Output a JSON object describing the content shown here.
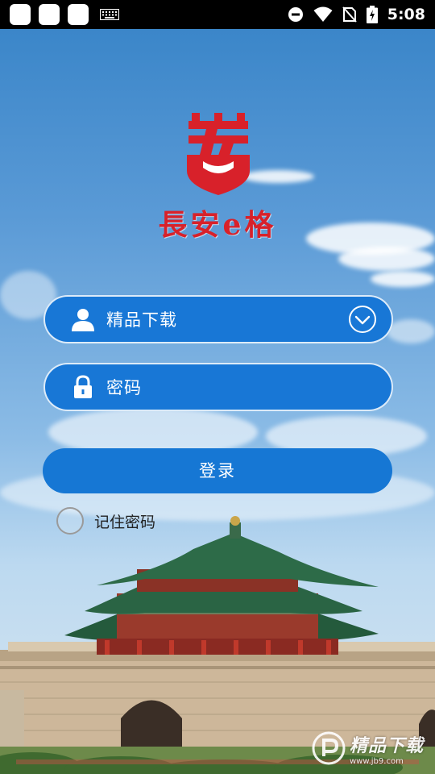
{
  "status_bar": {
    "time": "5:08",
    "icons": [
      "app-icon",
      "app-icon",
      "app-icon",
      "keyboard-icon",
      "dnd-icon",
      "wifi-icon",
      "no-sim-icon",
      "battery-icon"
    ]
  },
  "brand": {
    "logo_icon": "chang-an-logo",
    "name": "長安e格",
    "color": "#d8212a"
  },
  "form": {
    "username": {
      "icon": "user-icon",
      "value": "精品下载",
      "dropdown_icon": "chevron-down-icon"
    },
    "password": {
      "icon": "lock-icon",
      "placeholder": "密码"
    },
    "login_label": "登录",
    "remember_label": "记住密码",
    "accent": "#1677d4"
  },
  "watermark": {
    "main": "精品下载",
    "sub": "www.jb9.com"
  }
}
